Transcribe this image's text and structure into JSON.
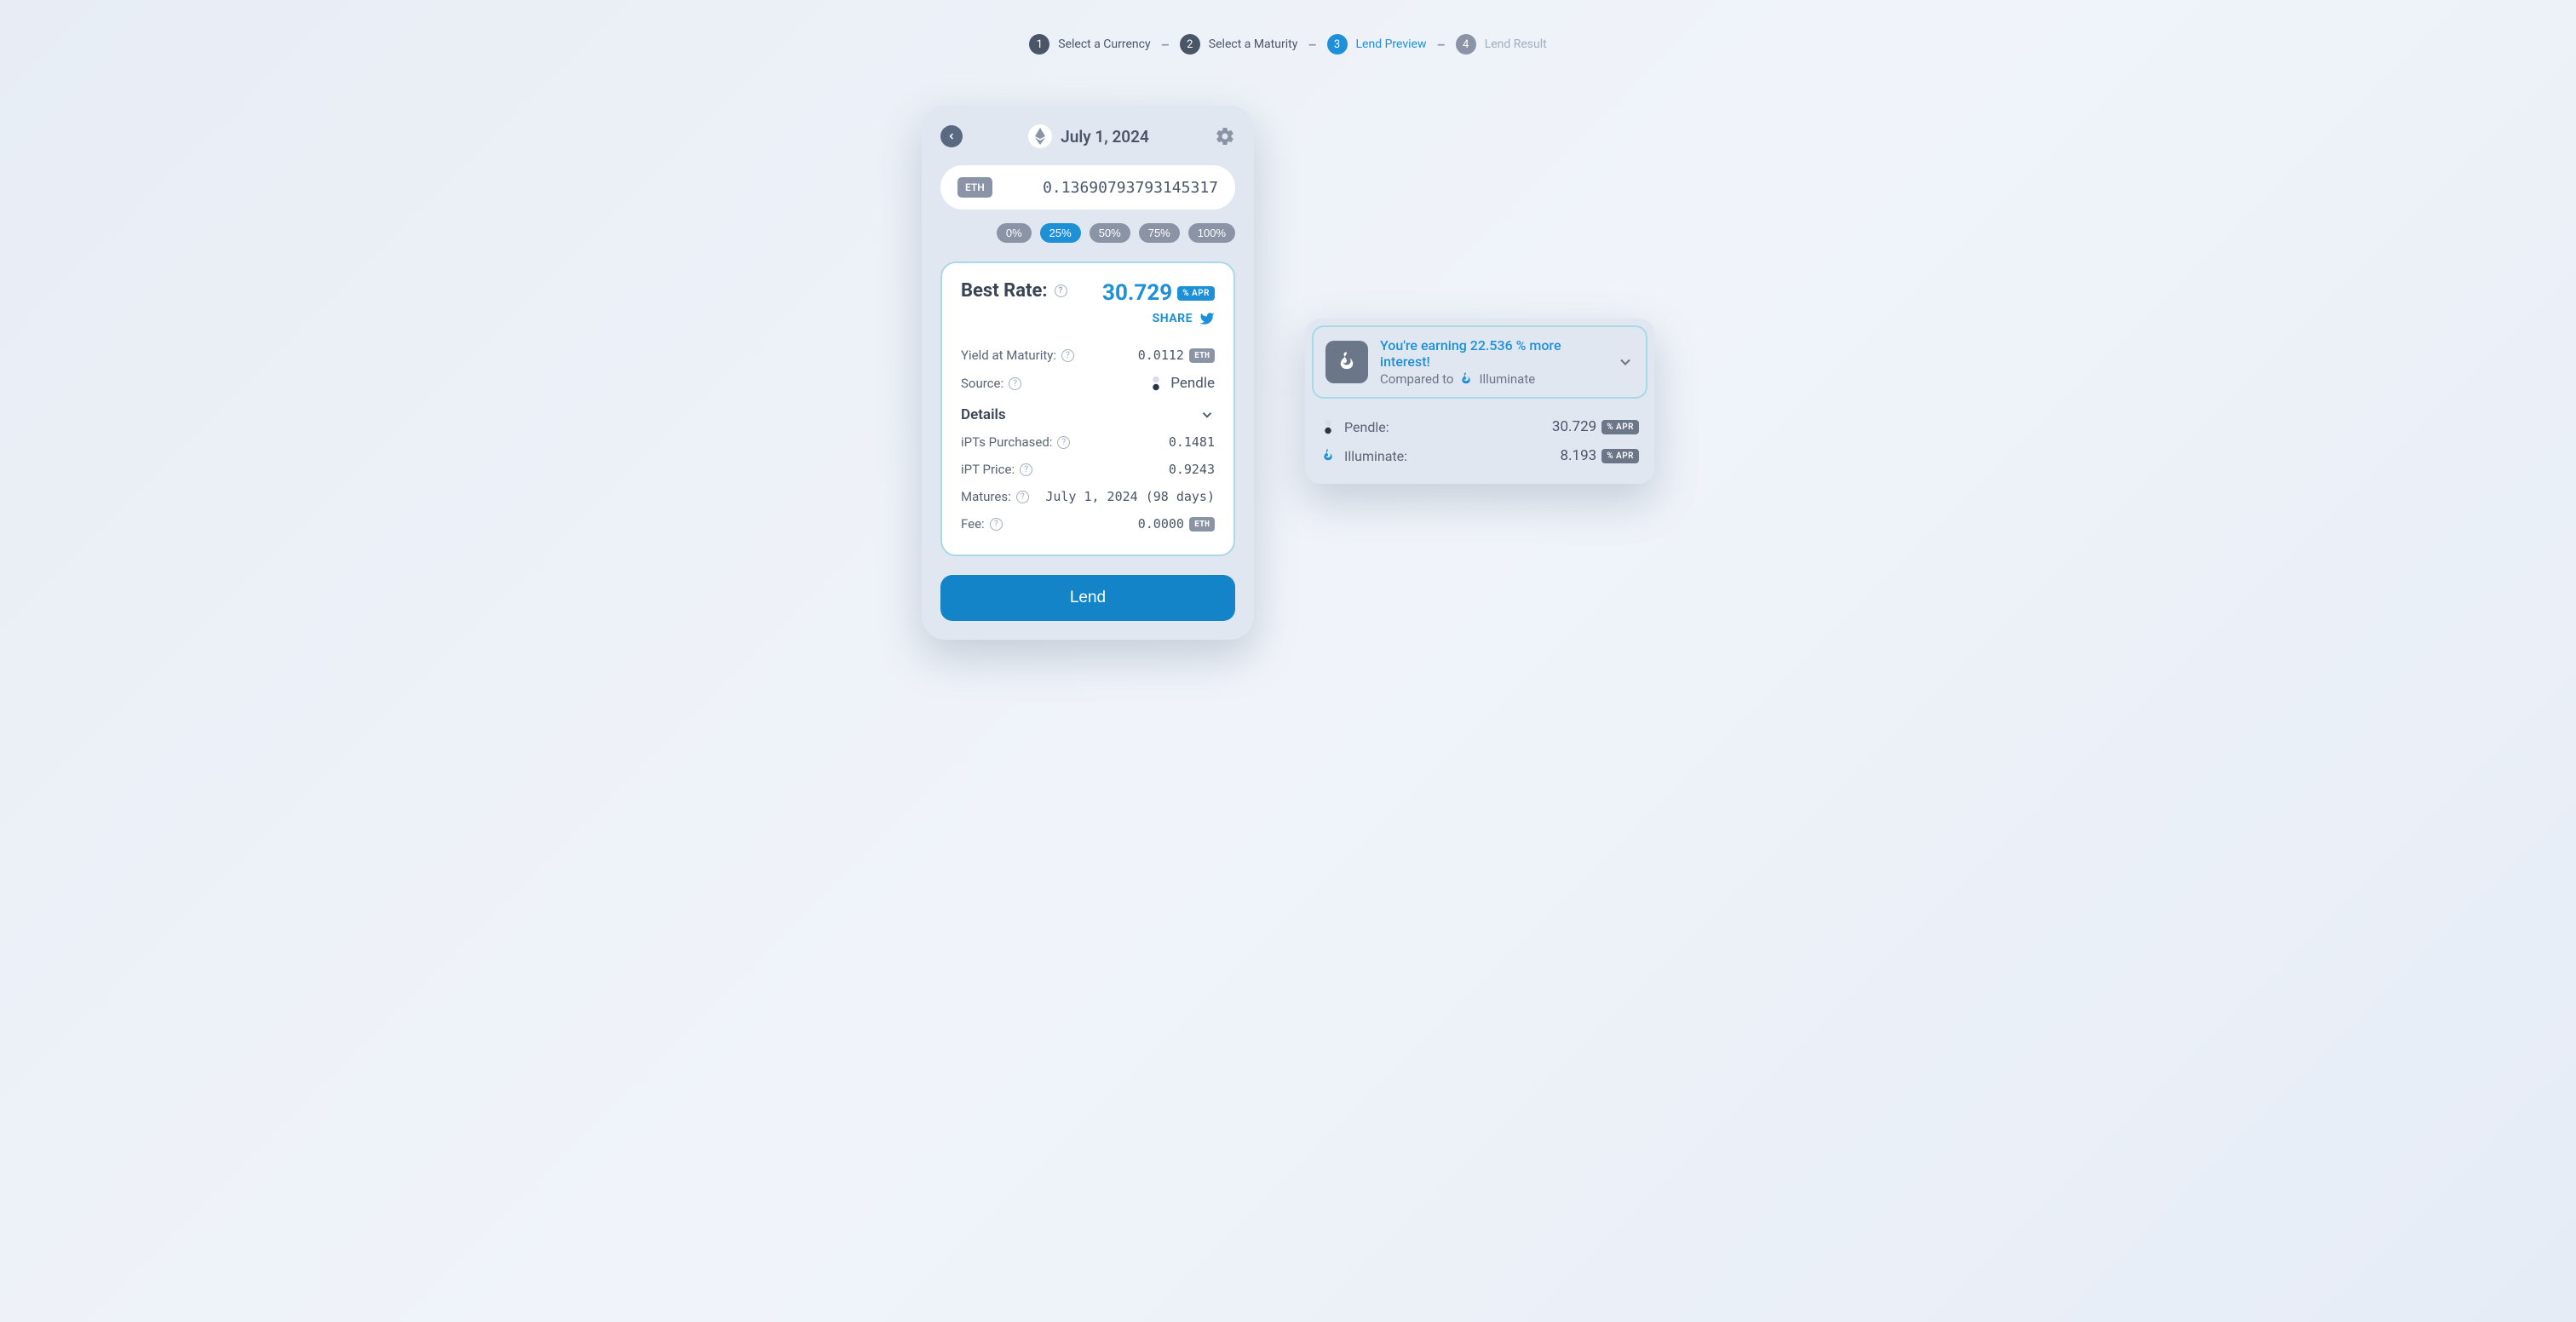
{
  "stepper": {
    "steps": [
      {
        "num": "1",
        "label": "Select a Currency",
        "state": "done"
      },
      {
        "num": "2",
        "label": "Select a Maturity",
        "state": "done"
      },
      {
        "num": "3",
        "label": "Lend Preview",
        "state": "active"
      },
      {
        "num": "4",
        "label": "Lend Result",
        "state": "inactive"
      }
    ]
  },
  "header": {
    "date": "July 1, 2024",
    "currency_badge": "ETH"
  },
  "amount": {
    "currency_badge": "ETH",
    "value": "0.13690793793145317"
  },
  "percent_buttons": [
    "0%",
    "25%",
    "50%",
    "75%",
    "100%"
  ],
  "percent_active_index": 1,
  "rate": {
    "title": "Best Rate:",
    "value": "30.729",
    "apr_label": "% APR",
    "share_label": "SHARE"
  },
  "details": {
    "yield_label": "Yield at Maturity:",
    "yield_value": "0.0112",
    "yield_unit": "ETH",
    "source_label": "Source:",
    "source_value": "Pendle",
    "details_label": "Details",
    "ipts_label": "iPTs Purchased:",
    "ipts_value": "0.1481",
    "ipt_price_label": "iPT Price:",
    "ipt_price_value": "0.9243",
    "matures_label": "Matures:",
    "matures_value": "July 1, 2024 (98 days)",
    "fee_label": "Fee:",
    "fee_value": "0.0000",
    "fee_unit": "ETH"
  },
  "lend_button": "Lend",
  "compare": {
    "headline": "You're earning 22.536 % more interest!",
    "subline_prefix": "Compared to",
    "subline_name": "Illuminate",
    "rows": [
      {
        "name": "Pendle:",
        "value": "30.729",
        "apr": "% APR",
        "icon": "pendle"
      },
      {
        "name": "Illuminate:",
        "value": "8.193",
        "apr": "% APR",
        "icon": "flame"
      }
    ]
  }
}
